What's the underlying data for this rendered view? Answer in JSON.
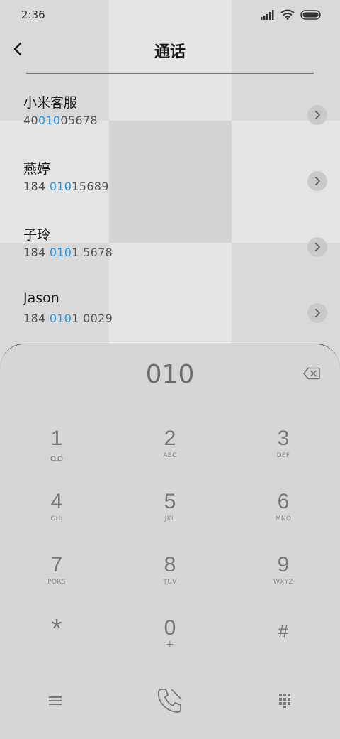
{
  "status_bar": {
    "time": "2:36"
  },
  "header": {
    "title": "通话"
  },
  "contacts": [
    {
      "name": "小米客服",
      "num_pre": "40",
      "num_hl": "010",
      "num_post": "05678"
    },
    {
      "name": "燕婷",
      "num_pre": "184 ",
      "num_hl": "010",
      "num_post": "15689"
    },
    {
      "name": "子玲",
      "num_pre": "184 ",
      "num_hl": "010",
      "num_post": "1 5678"
    },
    {
      "name": "Jason",
      "num_pre": "184 ",
      "num_hl": "010",
      "num_post": "1 0029"
    }
  ],
  "dialpad": {
    "display": "010",
    "keys": [
      {
        "digit": "1",
        "letters": ""
      },
      {
        "digit": "2",
        "letters": "ABC"
      },
      {
        "digit": "3",
        "letters": "DEF"
      },
      {
        "digit": "4",
        "letters": "GHI"
      },
      {
        "digit": "5",
        "letters": "JKL"
      },
      {
        "digit": "6",
        "letters": "MNO"
      },
      {
        "digit": "7",
        "letters": "PQRS"
      },
      {
        "digit": "8",
        "letters": "TUV"
      },
      {
        "digit": "9",
        "letters": "WXYZ"
      },
      {
        "digit": "*",
        "letters": ""
      },
      {
        "digit": "0",
        "letters": "+"
      },
      {
        "digit": "#",
        "letters": ""
      }
    ]
  },
  "colors": {
    "highlight": "#2196f3",
    "background": "#dcdcdc"
  }
}
